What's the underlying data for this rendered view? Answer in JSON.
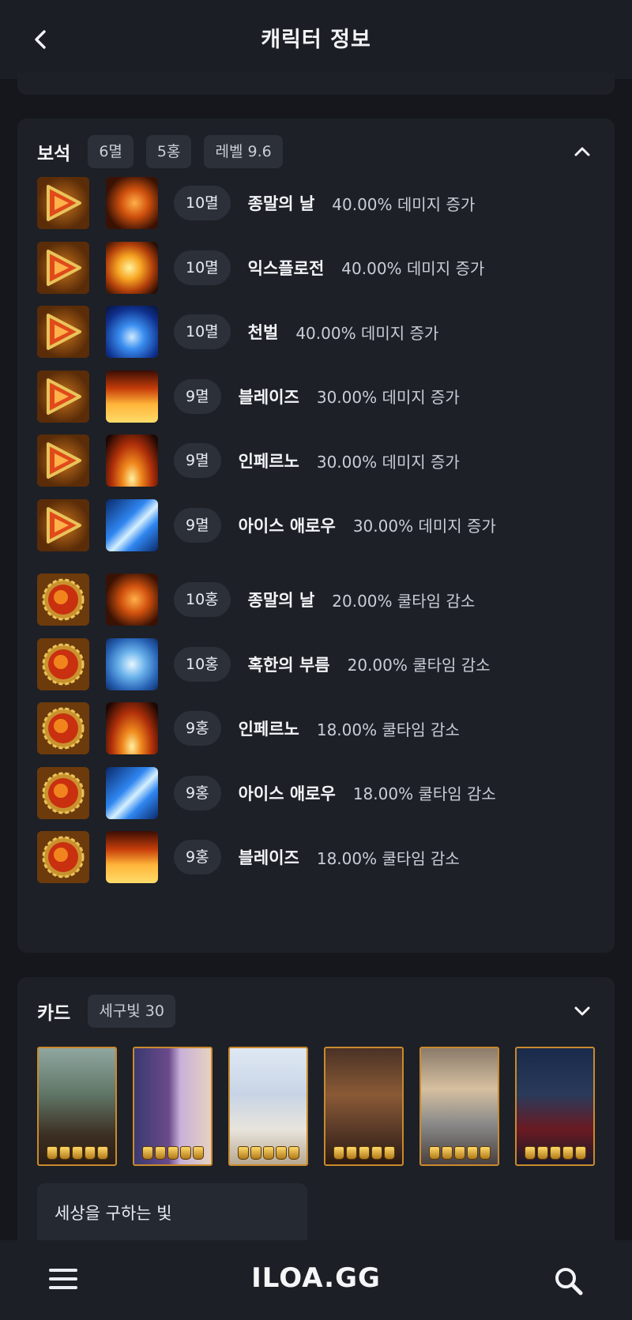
{
  "header": {
    "title": "캐릭터 정보",
    "back_icon": "chevron-left-icon"
  },
  "gems_section": {
    "title": "보석",
    "chips": [
      "6멸",
      "5홍",
      "레벨 9.6"
    ],
    "collapse_icon": "chevron-up-icon",
    "gems": [
      {
        "level": "10멸",
        "skill": "종말의 날",
        "effect": "40.00% 데미지 증가",
        "gem_type": "destruction",
        "skill_icon": "meteor-icon"
      },
      {
        "level": "10멸",
        "skill": "익스플로전",
        "effect": "40.00% 데미지 증가",
        "gem_type": "destruction",
        "skill_icon": "explosion-icon"
      },
      {
        "level": "10멸",
        "skill": "천벌",
        "effect": "40.00% 데미지 증가",
        "gem_type": "destruction",
        "skill_icon": "lightning-icon"
      },
      {
        "level": "9멸",
        "skill": "블레이즈",
        "effect": "30.00% 데미지 증가",
        "gem_type": "destruction",
        "skill_icon": "blaze-icon"
      },
      {
        "level": "9멸",
        "skill": "인페르노",
        "effect": "30.00% 데미지 증가",
        "gem_type": "destruction",
        "skill_icon": "inferno-icon"
      },
      {
        "level": "9멸",
        "skill": "아이스 애로우",
        "effect": "30.00% 데미지 증가",
        "gem_type": "destruction",
        "skill_icon": "ice-arrow-icon"
      },
      {
        "level": "10홍",
        "skill": "종말의 날",
        "effect": "20.00% 쿨타임 감소",
        "gem_type": "crimson",
        "skill_icon": "meteor-icon"
      },
      {
        "level": "10홍",
        "skill": "혹한의 부름",
        "effect": "20.00% 쿨타임 감소",
        "gem_type": "crimson",
        "skill_icon": "frost-icon"
      },
      {
        "level": "9홍",
        "skill": "인페르노",
        "effect": "18.00% 쿨타임 감소",
        "gem_type": "crimson",
        "skill_icon": "inferno-icon"
      },
      {
        "level": "9홍",
        "skill": "아이스 애로우",
        "effect": "18.00% 쿨타임 감소",
        "gem_type": "crimson",
        "skill_icon": "ice-arrow-icon"
      },
      {
        "level": "9홍",
        "skill": "블레이즈",
        "effect": "18.00% 쿨타임 감소",
        "gem_type": "crimson",
        "skill_icon": "blaze-icon"
      }
    ]
  },
  "cards_section": {
    "title": "카드",
    "chip": "세구빛 30",
    "expand_icon": "chevron-down-icon",
    "cards": [
      {
        "awakening": 5,
        "palette": "forest"
      },
      {
        "awakening": 5,
        "palette": "twin"
      },
      {
        "awakening": 5,
        "palette": "angel"
      },
      {
        "awakening": 5,
        "palette": "armor"
      },
      {
        "awakening": 5,
        "palette": "knight"
      },
      {
        "awakening": 5,
        "palette": "dark"
      }
    ],
    "set_name": "세상을 구하는 빛"
  },
  "bottom_bar": {
    "logo": "ILOA.GG",
    "menu_icon": "hamburger-menu-icon",
    "search_icon": "search-icon"
  },
  "colors": {
    "background": "#15171c",
    "panel": "#1d2027",
    "chip": "#2c3039",
    "card_border": "#c98a2c"
  }
}
